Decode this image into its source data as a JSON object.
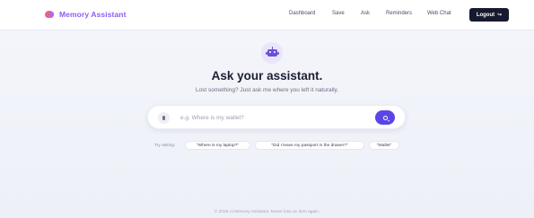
{
  "app": {
    "brand_name": "Memory Assistant",
    "brand_color": "#8b5cf6",
    "brand_icon": "brain-icon"
  },
  "nav": {
    "items": [
      {
        "label": "Dashboard"
      },
      {
        "label": "Save"
      },
      {
        "label": "Ask"
      },
      {
        "label": "Reminders"
      },
      {
        "label": "Web Chat"
      }
    ],
    "logout_label": "Logout",
    "logout_icon": "logout-icon"
  },
  "hero": {
    "icon": "robot-icon",
    "title": "Ask your assistant.",
    "subtitle": "Lost something? Just ask me where you left it naturally."
  },
  "search": {
    "placeholder": "e.g. Where is my wallet?",
    "value": "",
    "mic_icon": "microphone-icon",
    "submit_icon": "search-icon",
    "accent": "#5b45e6"
  },
  "suggestions": {
    "prefix": "Try asking:",
    "chips": [
      "\"Where is my laptop?\"",
      "\"Did I leave my passport in the drawer?\"",
      "\"Wallet\""
    ]
  },
  "footer": {
    "text": "© 2026 AI Memory Assistant. Never lose an item again."
  }
}
